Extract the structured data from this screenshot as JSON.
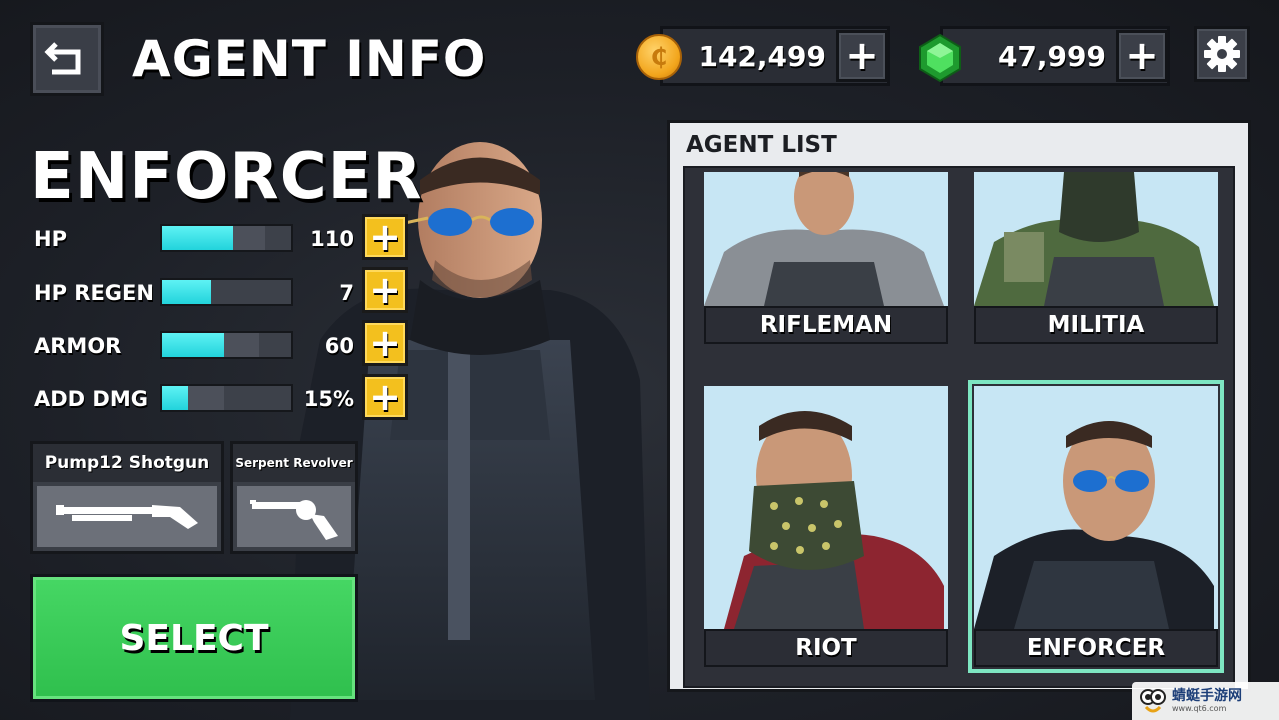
{
  "header": {
    "title": "AGENT INFO",
    "coins": "142,499",
    "gems": "47,999",
    "plus_label": "+"
  },
  "agent": {
    "name": "ENFORCER",
    "stats": [
      {
        "label": "HP",
        "value": "110",
        "level": 0.55
      },
      {
        "label": "HP REGEN",
        "value": "7",
        "level": 0.38
      },
      {
        "label": "ARMOR",
        "value": "60",
        "level": 0.48
      },
      {
        "label": "ADD DMG",
        "value": "15%",
        "level": 0.2
      }
    ],
    "stat_plus": "+"
  },
  "weapons": [
    {
      "name": "Pump12 Shotgun"
    },
    {
      "name": "Serpent Revolver"
    }
  ],
  "select_label": "SELECT",
  "agent_list": {
    "title": "AGENT LIST",
    "agents": [
      {
        "name": "RIFLEMAN",
        "selected": false
      },
      {
        "name": "MILITIA",
        "selected": false
      },
      {
        "name": "RIOT",
        "selected": false
      },
      {
        "name": "ENFORCER",
        "selected": true
      }
    ]
  },
  "watermark": {
    "text": "蜻蜓手游网",
    "sub": "www.qt6.com"
  },
  "colors": {
    "accent_cyan": "#22d3dc",
    "plus_yellow": "#f3c01e",
    "select_green": "#2fbf4d",
    "selected_outline": "#7ee6c2"
  }
}
